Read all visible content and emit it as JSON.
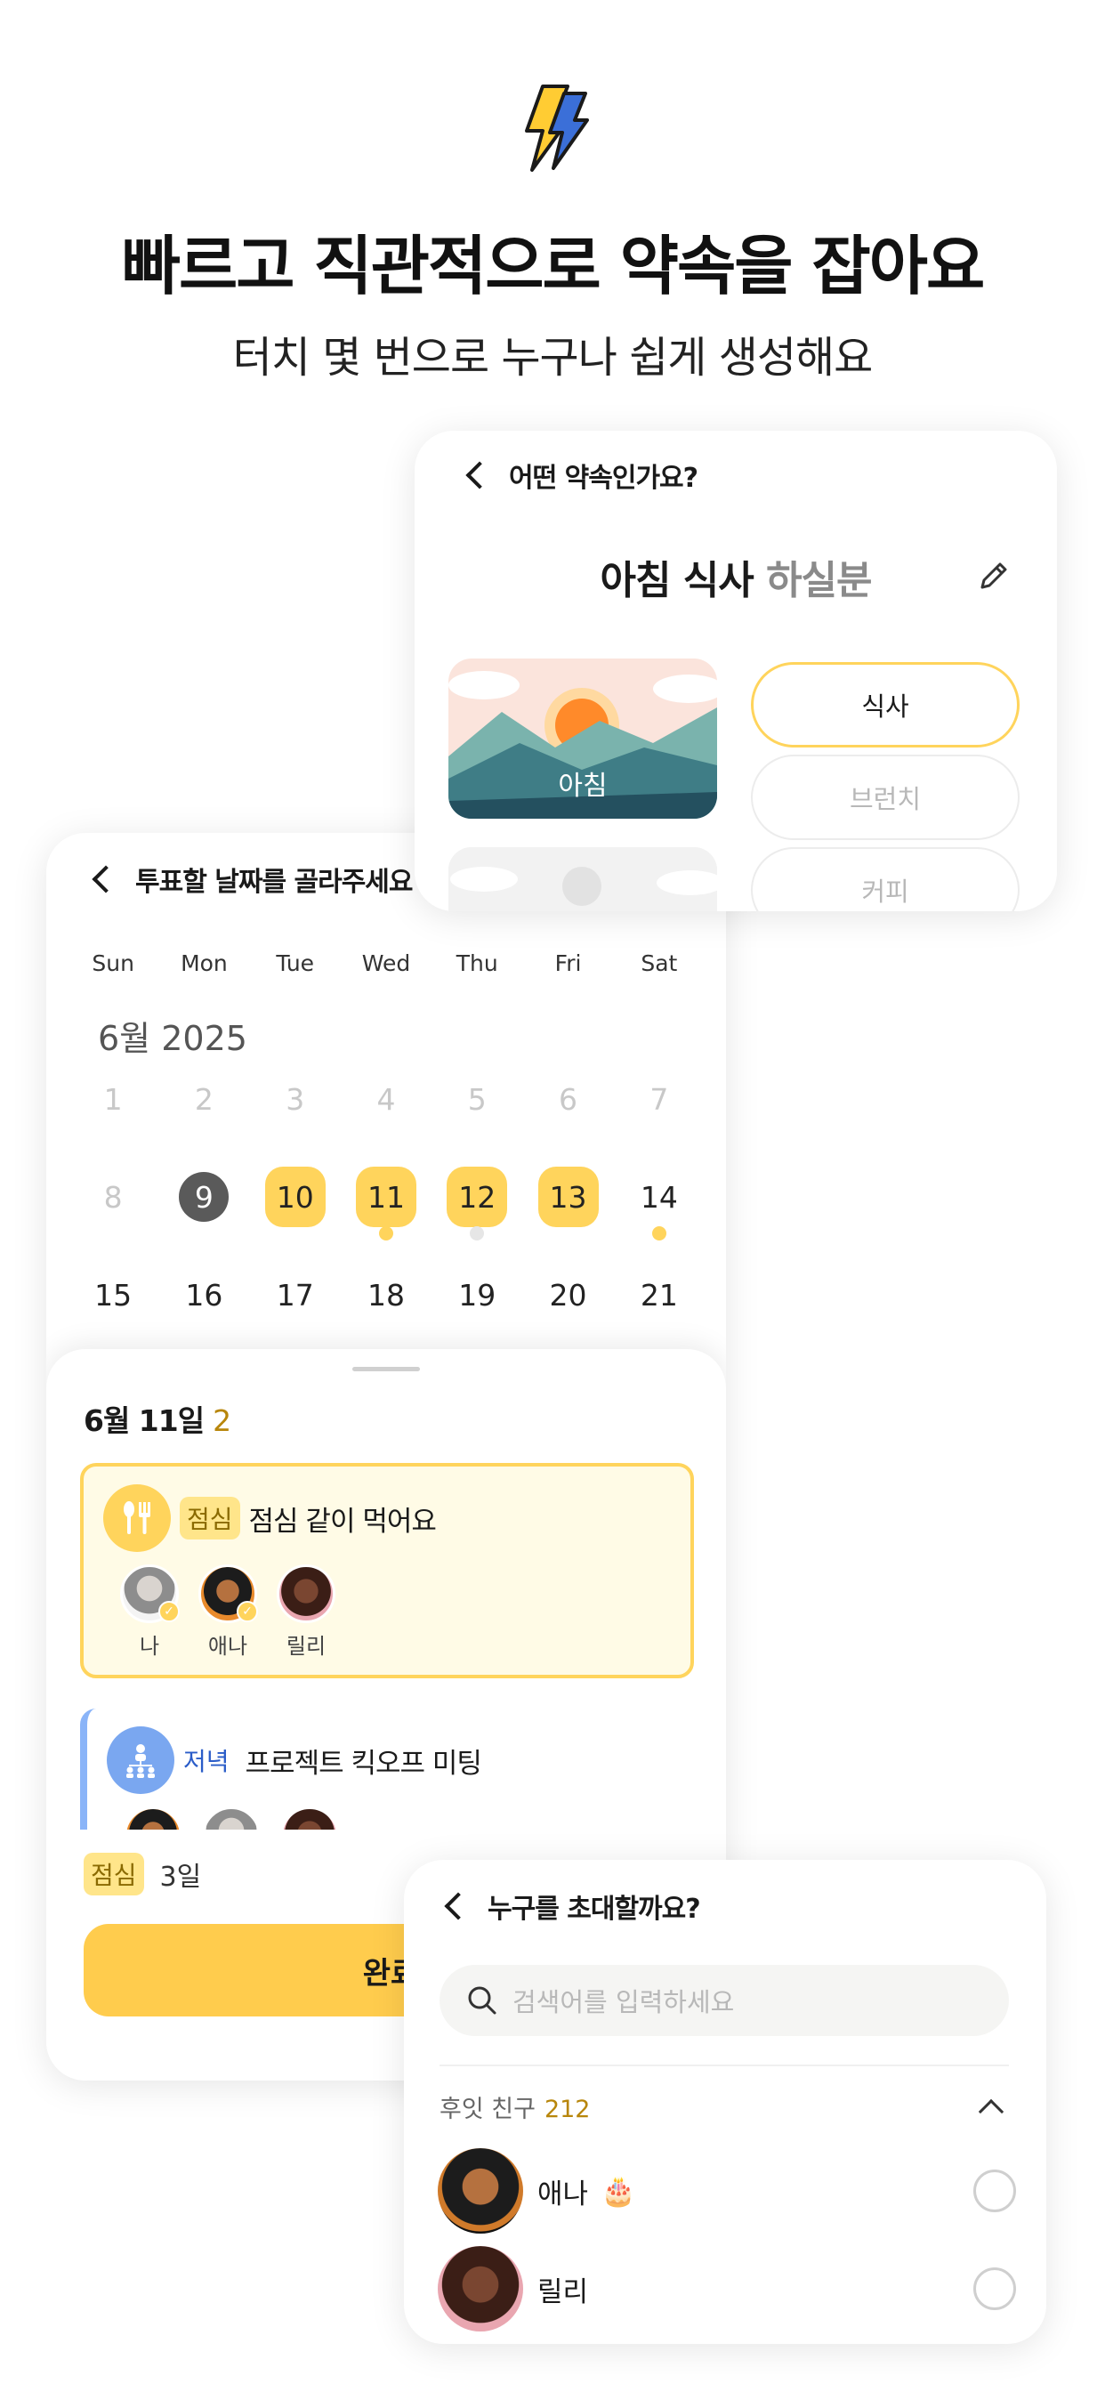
{
  "hero": {
    "icon": "lightning-bolt-icon",
    "headline": "빠르고 직관적으로 약속을 잡아요",
    "subline": "터치 몇 번으로 누구나 쉽게 생성해요"
  },
  "type_card": {
    "back_icon": "chevron-left-icon",
    "nav_title": "어떤 약속인가요?",
    "title_main": "아침 식사",
    "title_placeholder": "하실분",
    "edit_icon": "pencil-icon",
    "thumb_label": "아침",
    "options": [
      "식사",
      "브런치",
      "커피"
    ],
    "selected_option": "식사"
  },
  "calendar_card": {
    "nav_title": "투표할 날짜를 골라주세요",
    "weekdays": [
      "Sun",
      "Mon",
      "Tue",
      "Wed",
      "Thu",
      "Fri",
      "Sat"
    ],
    "month": "6월 2025",
    "week1": [
      "1",
      "2",
      "3",
      "4",
      "5",
      "6",
      "7"
    ],
    "week2": [
      "8",
      "9",
      "10",
      "11",
      "12",
      "13",
      "14"
    ],
    "week3": [
      "15",
      "16",
      "17",
      "18",
      "19",
      "20",
      "21"
    ],
    "today": "9",
    "highlighted": [
      "10",
      "11",
      "12",
      "13"
    ]
  },
  "sheet": {
    "date": "6월 11일",
    "count": "2",
    "events": [
      {
        "tag": "점심",
        "title": "점심 같이 먹어요",
        "icon": "fork-spoon-icon",
        "people": [
          "나",
          "애나",
          "릴리"
        ]
      },
      {
        "tag": "저녁",
        "title": "프로젝트 킥오프 미팅",
        "icon": "group-icon"
      }
    ],
    "footer_tag": "점심",
    "footer_days": "3일",
    "done_label": "완료"
  },
  "invite_card": {
    "nav_title": "누구를 초대할까요?",
    "search_placeholder": "검색어를 입력하세요",
    "friends_label": "후잇 친구",
    "friends_count": "212",
    "friends": [
      {
        "name": "애나",
        "badge": "🎂"
      },
      {
        "name": "릴리"
      }
    ]
  },
  "colors": {
    "accent_yellow": "#ffd45c",
    "button_yellow": "#ffcc4d",
    "accent_blue": "#7aa7f0",
    "count_gold": "#b8860b"
  }
}
